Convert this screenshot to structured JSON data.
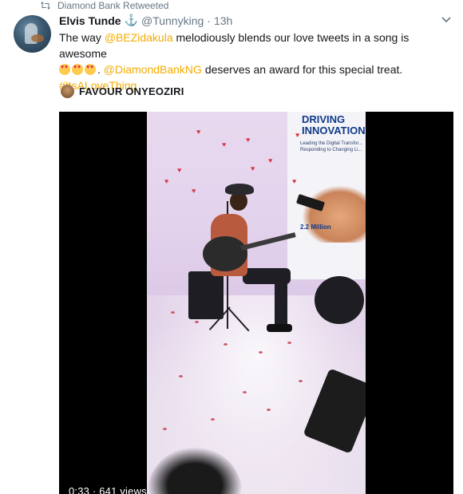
{
  "retweet": {
    "label": "Diamond Bank Retweeted"
  },
  "tweet": {
    "author_name": "Elvis Tunde",
    "handle": "@Tunnyking",
    "separator": "·",
    "time": "13h",
    "text": {
      "p1": "The way ",
      "mention1": "@BEZidakula",
      "p2": " melodiously blends our love tweets in a song is awesome",
      "p3": ". ",
      "mention2": "@DiamondBankNG",
      "p4": " deserves an award for this special treat.",
      "hashtag": "#ItsALoveThing"
    },
    "emoji_icons": [
      "heart-eyes-emoji-icon",
      "heart-eyes-emoji-icon",
      "heart-eyes-emoji-icon"
    ]
  },
  "embed": {
    "title": "FAVOUR ONYEOZIRI"
  },
  "video": {
    "banner_line1": "DRIVING",
    "banner_line2": "INNOVATION",
    "banner_sub": "Leading the Digital Transfor... Responding to Changing Li...",
    "banner_stat": "2.2 Million",
    "stats": "0:33 · 641 views"
  },
  "colors": {
    "accent": "#f4ab00",
    "muted": "#657786",
    "link_blue": "#1b95e0"
  }
}
